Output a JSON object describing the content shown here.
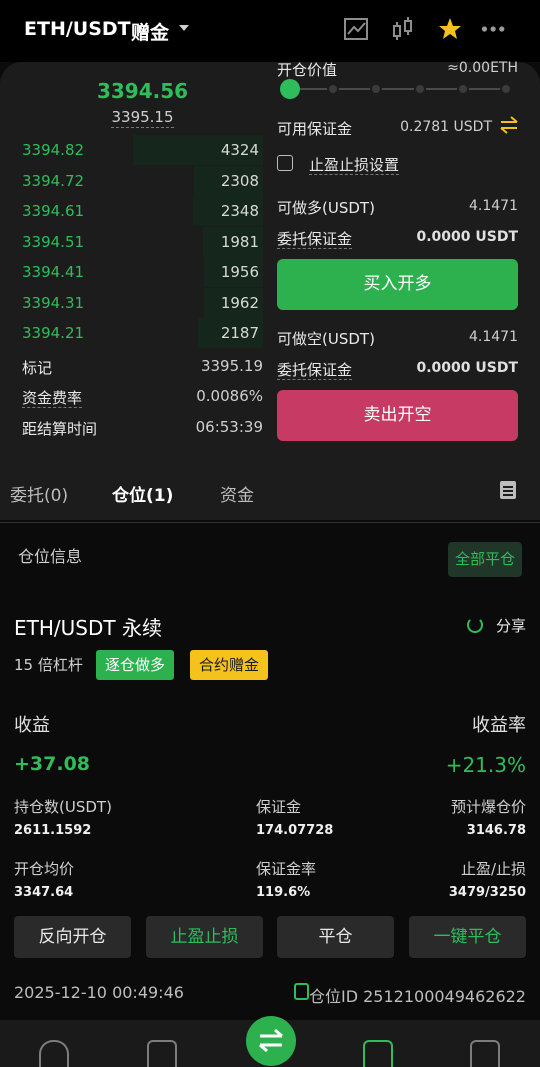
{
  "header": {
    "pair": "ETH/USDT",
    "mode": "赠金",
    "icons": [
      "chart-icon",
      "candlestick-icon",
      "star-icon",
      "more-icon"
    ]
  },
  "orderbook": {
    "last_price": "3394.56",
    "mark_price": "3395.15",
    "bids": [
      {
        "price": "3394.82",
        "qty": "4324",
        "depth": 1.0
      },
      {
        "price": "3394.72",
        "qty": "2308",
        "depth": 0.53
      },
      {
        "price": "3394.61",
        "qty": "2348",
        "depth": 0.54
      },
      {
        "price": "3394.51",
        "qty": "1981",
        "depth": 0.46
      },
      {
        "price": "3394.41",
        "qty": "1956",
        "depth": 0.45
      },
      {
        "price": "3394.31",
        "qty": "1962",
        "depth": 0.45
      },
      {
        "price": "3394.21",
        "qty": "2187",
        "depth": 0.5
      }
    ],
    "stats": [
      {
        "label": "标记",
        "value": "3395.19"
      },
      {
        "label": "资金费率",
        "value": "0.0086%"
      },
      {
        "label": "距结算时间",
        "value": "06:53:39"
      }
    ]
  },
  "form": {
    "open_value_label": "开仓价值",
    "open_value": "≈0.00ETH",
    "available_margin_label": "可用保证金",
    "available_margin": "0.2781 USDT",
    "tpsl_label": "止盈止损设置",
    "long_max_label": "可做多(USDT)",
    "long_max": "4.1471",
    "long_margin_label": "委托保证金",
    "long_margin": "0.0000 USDT",
    "buy_button": "买入开多",
    "short_max_label": "可做空(USDT)",
    "short_max": "4.1471",
    "short_margin_label": "委托保证金",
    "short_margin": "0.0000 USDT",
    "sell_button": "卖出开空",
    "slider_level": 0
  },
  "tabs": [
    {
      "label": "委托(0)",
      "active": false
    },
    {
      "label": "仓位(1)",
      "active": true
    },
    {
      "label": "资金",
      "active": false
    }
  ],
  "position": {
    "section_title": "仓位信息",
    "close_all": "全部平仓",
    "name": "ETH/USDT 永续",
    "share": "分享",
    "leverage": "15 倍杠杆",
    "badge_mode": "逐仓做多",
    "badge_bonus": "合约赠金",
    "pnl_label": "收益",
    "pnl": "+37.08",
    "roe_label": "收益率",
    "roe": "+21.3%",
    "size_label": "持仓数(USDT)",
    "size": "2611.1592",
    "margin_label": "保证金",
    "margin": "174.07728",
    "liq_label": "预计爆仓价",
    "liq": "3146.78",
    "entry_label": "开仓均价",
    "entry": "3347.64",
    "margin_ratio_label": "保证金率",
    "margin_ratio": "119.6%",
    "tpsl_label": "止盈/止损",
    "tpsl": "3479/3250",
    "actions": [
      "反向开仓",
      "止盈止损",
      "平仓",
      "一键平仓"
    ],
    "time": "2025-12-10 00:49:46",
    "position_id": "仓位ID 2512100049462622"
  },
  "colors": {
    "green": "#2fbd5c",
    "red": "#c73a63",
    "yellow": "#f4c21c"
  }
}
